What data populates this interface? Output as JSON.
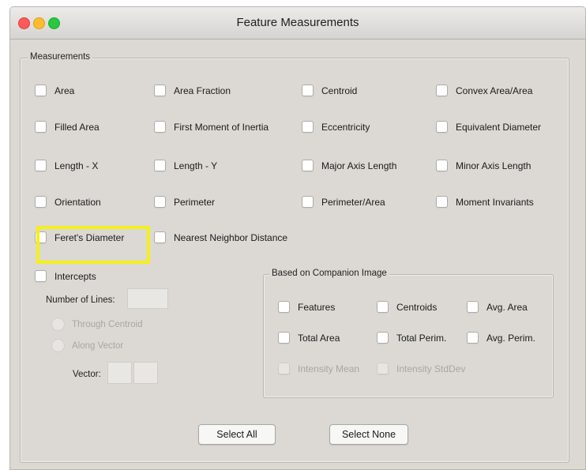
{
  "window": {
    "title": "Feature Measurements"
  },
  "measurements": {
    "legend": "Measurements",
    "items": [
      {
        "label": "Area"
      },
      {
        "label": "Area Fraction"
      },
      {
        "label": "Centroid"
      },
      {
        "label": "Convex Area/Area"
      },
      {
        "label": "Filled Area"
      },
      {
        "label": "First Moment of Inertia"
      },
      {
        "label": "Eccentricity"
      },
      {
        "label": "Equivalent Diameter"
      },
      {
        "label": "Length - X"
      },
      {
        "label": "Length - Y"
      },
      {
        "label": "Major Axis Length"
      },
      {
        "label": "Minor Axis Length"
      },
      {
        "label": "Orientation"
      },
      {
        "label": "Perimeter"
      },
      {
        "label": "Perimeter/Area"
      },
      {
        "label": "Moment Invariants"
      },
      {
        "label": "Feret's Diameter"
      },
      {
        "label": "Nearest Neighbor Distance"
      }
    ]
  },
  "intercepts": {
    "label": "Intercepts",
    "number_of_lines_label": "Number of Lines:",
    "number_of_lines_value": "",
    "through_centroid_label": "Through Centroid",
    "along_vector_label": "Along Vector",
    "vector_label": "Vector:",
    "vector_x": "",
    "vector_y": ""
  },
  "companion": {
    "legend": "Based on Companion Image",
    "items": [
      {
        "label": "Features"
      },
      {
        "label": "Centroids"
      },
      {
        "label": "Avg. Area"
      },
      {
        "label": "Total Area"
      },
      {
        "label": "Total Perim."
      },
      {
        "label": "Avg. Perim."
      },
      {
        "label": "Intensity Mean"
      },
      {
        "label": "Intensity StdDev"
      }
    ]
  },
  "buttons": {
    "select_all": "Select All",
    "select_none": "Select None"
  },
  "colors": {
    "highlight": "#f5ef1c",
    "window_bg": "#dcd9d4"
  }
}
